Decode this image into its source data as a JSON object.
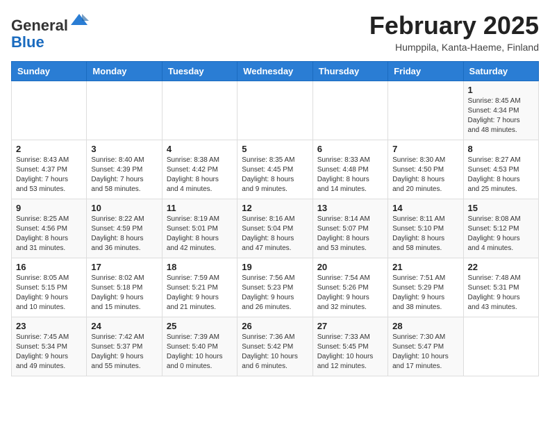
{
  "header": {
    "logo_general": "General",
    "logo_blue": "Blue",
    "month_title": "February 2025",
    "location": "Humppila, Kanta-Haeme, Finland"
  },
  "days_of_week": [
    "Sunday",
    "Monday",
    "Tuesday",
    "Wednesday",
    "Thursday",
    "Friday",
    "Saturday"
  ],
  "weeks": [
    [
      {
        "day": "",
        "info": ""
      },
      {
        "day": "",
        "info": ""
      },
      {
        "day": "",
        "info": ""
      },
      {
        "day": "",
        "info": ""
      },
      {
        "day": "",
        "info": ""
      },
      {
        "day": "",
        "info": ""
      },
      {
        "day": "1",
        "info": "Sunrise: 8:45 AM\nSunset: 4:34 PM\nDaylight: 7 hours\nand 48 minutes."
      }
    ],
    [
      {
        "day": "2",
        "info": "Sunrise: 8:43 AM\nSunset: 4:37 PM\nDaylight: 7 hours\nand 53 minutes."
      },
      {
        "day": "3",
        "info": "Sunrise: 8:40 AM\nSunset: 4:39 PM\nDaylight: 7 hours\nand 58 minutes."
      },
      {
        "day": "4",
        "info": "Sunrise: 8:38 AM\nSunset: 4:42 PM\nDaylight: 8 hours\nand 4 minutes."
      },
      {
        "day": "5",
        "info": "Sunrise: 8:35 AM\nSunset: 4:45 PM\nDaylight: 8 hours\nand 9 minutes."
      },
      {
        "day": "6",
        "info": "Sunrise: 8:33 AM\nSunset: 4:48 PM\nDaylight: 8 hours\nand 14 minutes."
      },
      {
        "day": "7",
        "info": "Sunrise: 8:30 AM\nSunset: 4:50 PM\nDaylight: 8 hours\nand 20 minutes."
      },
      {
        "day": "8",
        "info": "Sunrise: 8:27 AM\nSunset: 4:53 PM\nDaylight: 8 hours\nand 25 minutes."
      }
    ],
    [
      {
        "day": "9",
        "info": "Sunrise: 8:25 AM\nSunset: 4:56 PM\nDaylight: 8 hours\nand 31 minutes."
      },
      {
        "day": "10",
        "info": "Sunrise: 8:22 AM\nSunset: 4:59 PM\nDaylight: 8 hours\nand 36 minutes."
      },
      {
        "day": "11",
        "info": "Sunrise: 8:19 AM\nSunset: 5:01 PM\nDaylight: 8 hours\nand 42 minutes."
      },
      {
        "day": "12",
        "info": "Sunrise: 8:16 AM\nSunset: 5:04 PM\nDaylight: 8 hours\nand 47 minutes."
      },
      {
        "day": "13",
        "info": "Sunrise: 8:14 AM\nSunset: 5:07 PM\nDaylight: 8 hours\nand 53 minutes."
      },
      {
        "day": "14",
        "info": "Sunrise: 8:11 AM\nSunset: 5:10 PM\nDaylight: 8 hours\nand 58 minutes."
      },
      {
        "day": "15",
        "info": "Sunrise: 8:08 AM\nSunset: 5:12 PM\nDaylight: 9 hours\nand 4 minutes."
      }
    ],
    [
      {
        "day": "16",
        "info": "Sunrise: 8:05 AM\nSunset: 5:15 PM\nDaylight: 9 hours\nand 10 minutes."
      },
      {
        "day": "17",
        "info": "Sunrise: 8:02 AM\nSunset: 5:18 PM\nDaylight: 9 hours\nand 15 minutes."
      },
      {
        "day": "18",
        "info": "Sunrise: 7:59 AM\nSunset: 5:21 PM\nDaylight: 9 hours\nand 21 minutes."
      },
      {
        "day": "19",
        "info": "Sunrise: 7:56 AM\nSunset: 5:23 PM\nDaylight: 9 hours\nand 26 minutes."
      },
      {
        "day": "20",
        "info": "Sunrise: 7:54 AM\nSunset: 5:26 PM\nDaylight: 9 hours\nand 32 minutes."
      },
      {
        "day": "21",
        "info": "Sunrise: 7:51 AM\nSunset: 5:29 PM\nDaylight: 9 hours\nand 38 minutes."
      },
      {
        "day": "22",
        "info": "Sunrise: 7:48 AM\nSunset: 5:31 PM\nDaylight: 9 hours\nand 43 minutes."
      }
    ],
    [
      {
        "day": "23",
        "info": "Sunrise: 7:45 AM\nSunset: 5:34 PM\nDaylight: 9 hours\nand 49 minutes."
      },
      {
        "day": "24",
        "info": "Sunrise: 7:42 AM\nSunset: 5:37 PM\nDaylight: 9 hours\nand 55 minutes."
      },
      {
        "day": "25",
        "info": "Sunrise: 7:39 AM\nSunset: 5:40 PM\nDaylight: 10 hours\nand 0 minutes."
      },
      {
        "day": "26",
        "info": "Sunrise: 7:36 AM\nSunset: 5:42 PM\nDaylight: 10 hours\nand 6 minutes."
      },
      {
        "day": "27",
        "info": "Sunrise: 7:33 AM\nSunset: 5:45 PM\nDaylight: 10 hours\nand 12 minutes."
      },
      {
        "day": "28",
        "info": "Sunrise: 7:30 AM\nSunset: 5:47 PM\nDaylight: 10 hours\nand 17 minutes."
      },
      {
        "day": "",
        "info": ""
      }
    ]
  ]
}
